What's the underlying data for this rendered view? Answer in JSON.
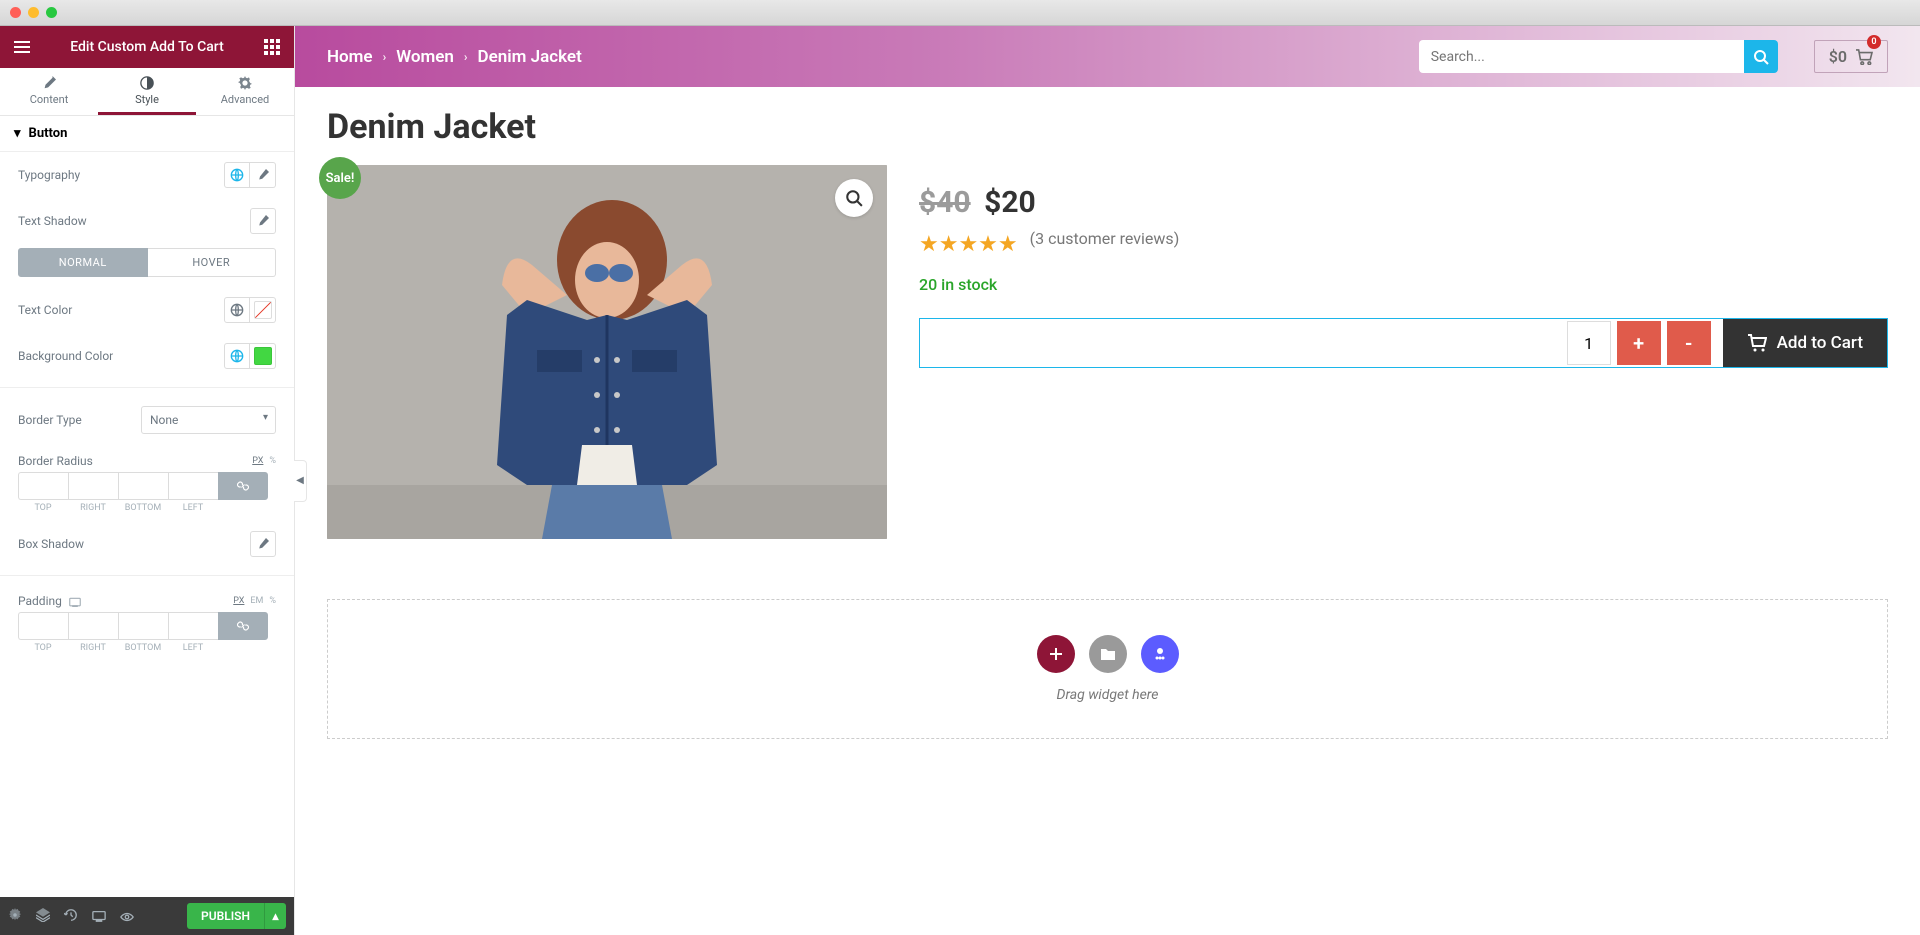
{
  "header": {
    "title": "Edit Custom Add To Cart"
  },
  "tabs": {
    "content": "Content",
    "style": "Style",
    "advanced": "Advanced"
  },
  "section": {
    "button": "Button"
  },
  "controls": {
    "typography": "Typography",
    "text_shadow": "Text Shadow",
    "text_color": "Text Color",
    "background_color": "Background Color",
    "border_type": "Border Type",
    "border_type_value": "None",
    "border_radius": "Border Radius",
    "box_shadow": "Box Shadow",
    "padding": "Padding"
  },
  "state_tabs": {
    "normal": "NORMAL",
    "hover": "HOVER"
  },
  "units": {
    "px": "PX",
    "em": "EM",
    "percent": "%"
  },
  "dim_labels": {
    "top": "TOP",
    "right": "RIGHT",
    "bottom": "BOTTOM",
    "left": "LEFT"
  },
  "footer": {
    "publish": "PUBLISH"
  },
  "breadcrumb": {
    "home": "Home",
    "women": "Women",
    "product": "Denim Jacket"
  },
  "search": {
    "placeholder": "Search..."
  },
  "cart": {
    "amount": "$0",
    "badge": "0"
  },
  "product": {
    "title": "Denim Jacket",
    "sale": "Sale!",
    "old_price": "$40",
    "price": "$20",
    "reviews": "(3 customer reviews)",
    "stock": "20 in stock",
    "qty": "1",
    "plus": "+",
    "minus": "-",
    "add_to_cart": "Add to Cart"
  },
  "dropzone": {
    "hint": "Drag widget here"
  }
}
